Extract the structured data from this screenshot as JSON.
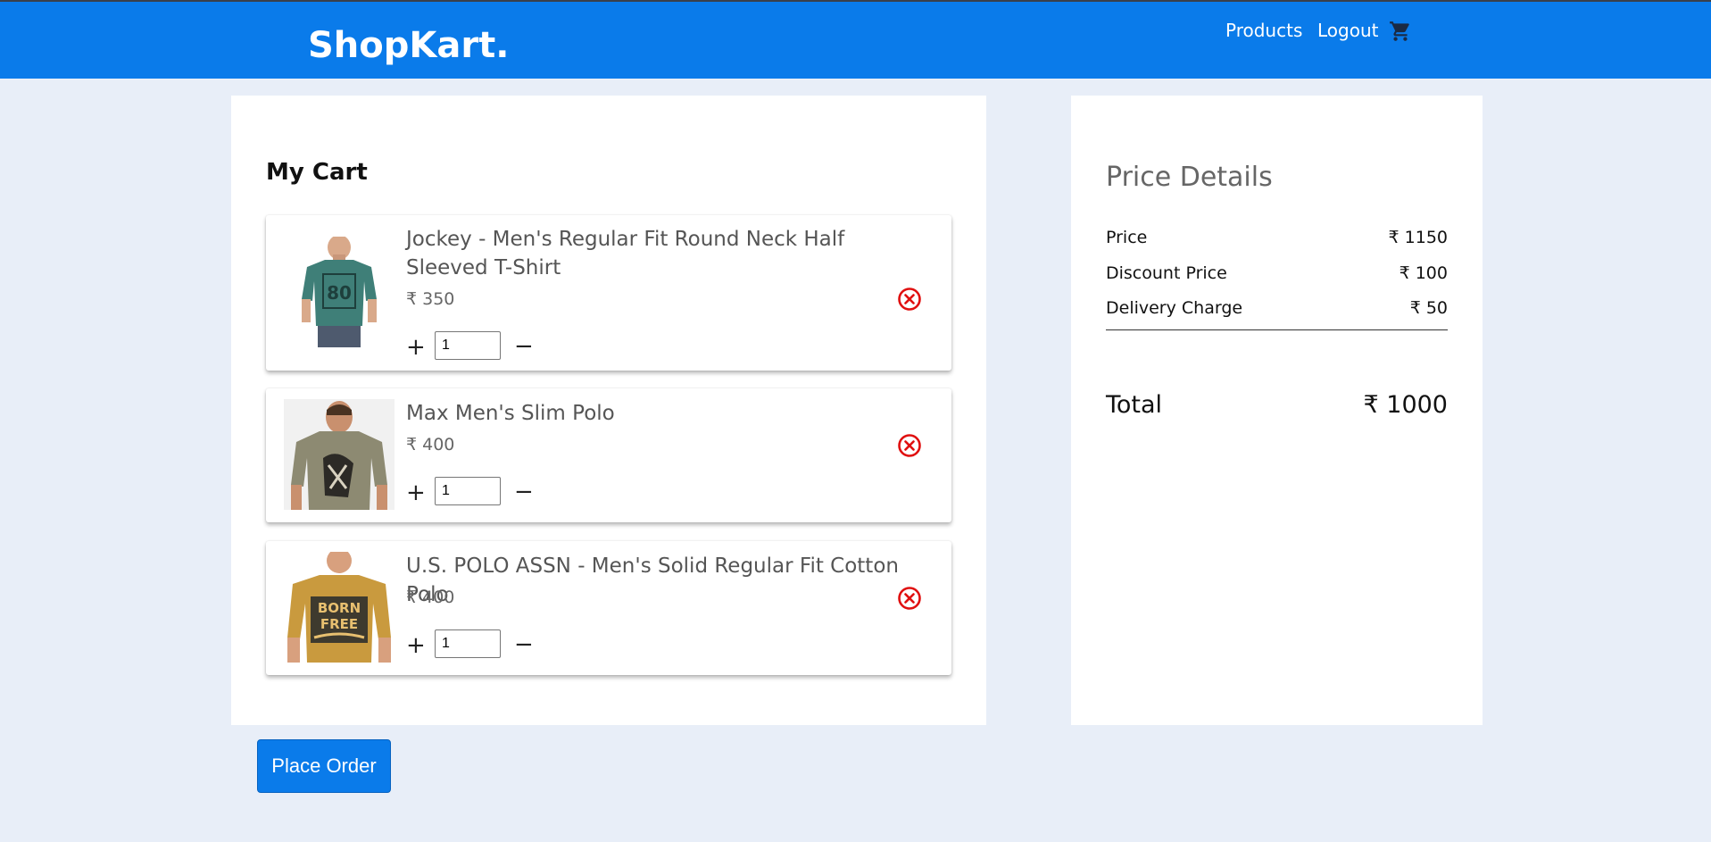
{
  "navbar": {
    "brand": "ShopKart.",
    "links": {
      "products": "Products",
      "logout": "Logout"
    },
    "cart_icon": "shopping-cart-icon",
    "background": "#0a7bea"
  },
  "cart": {
    "title": "My Cart",
    "items": [
      {
        "name": "Jockey - Men's Regular Fit Round Neck Half Sleeved T-Shirt",
        "price": "₹ 350",
        "quantity": "1",
        "plus": "+",
        "minus": "−",
        "image": "teal-tshirt-image"
      },
      {
        "name": "Max Men's Slim Polo",
        "price": "₹ 400",
        "quantity": "1",
        "plus": "+",
        "minus": "−",
        "image": "olive-tshirt-image"
      },
      {
        "name": "U.S. POLO ASSN - Men's Solid Regular Fit Cotton Polo",
        "price": "₹ 400",
        "quantity": "1",
        "plus": "+",
        "minus": "−",
        "image": "mustard-tshirt-image"
      }
    ],
    "remove_icon": "remove-circle-x-icon",
    "remove_color": "#e01010"
  },
  "price_details": {
    "title": "Price Details",
    "rows": [
      {
        "label": "Price",
        "value": "₹ 1150"
      },
      {
        "label": "Discount Price",
        "value": "₹ 100"
      },
      {
        "label": "Delivery Charge",
        "value": "₹ 50"
      }
    ],
    "total_label": "Total",
    "total_value": "₹ 1000"
  },
  "actions": {
    "place_order": "Place Order"
  }
}
